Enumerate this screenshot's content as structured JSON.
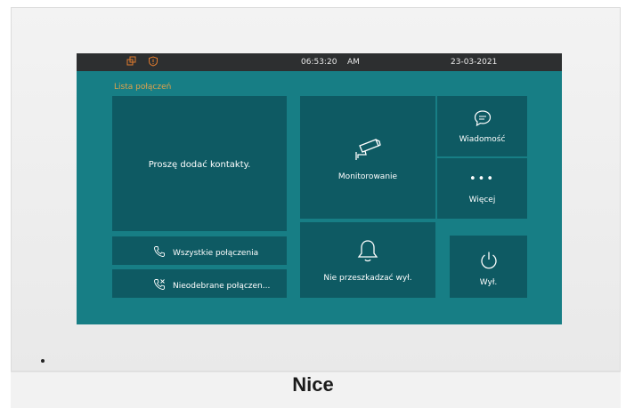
{
  "status_bar": {
    "time": "06:53:20",
    "ampm": "AM",
    "date": "23-03-2021",
    "icons": [
      "screens-icon",
      "shield-alert-icon"
    ],
    "icon_color": "#e07b2e"
  },
  "page": {
    "title": "Lista połączeń"
  },
  "tiles": {
    "contacts_placeholder": "Proszę dodać kontakty.",
    "all_calls": "Wszystkie połączenia",
    "missed_calls": "Nieodebrane połączen...",
    "monitoring": "Monitorowanie",
    "do_not_disturb": "Nie przeszkadzać wył.",
    "messages": "Wiadomość",
    "more_dots": "•••",
    "more": "Więcej",
    "off": "Wył."
  },
  "device": {
    "brand": "Nice"
  },
  "colors": {
    "screen_bg": "#177e85",
    "tile_bg": "#0e5a63",
    "status_bg": "#2d2f30",
    "title_accent": "#e1a24a"
  }
}
